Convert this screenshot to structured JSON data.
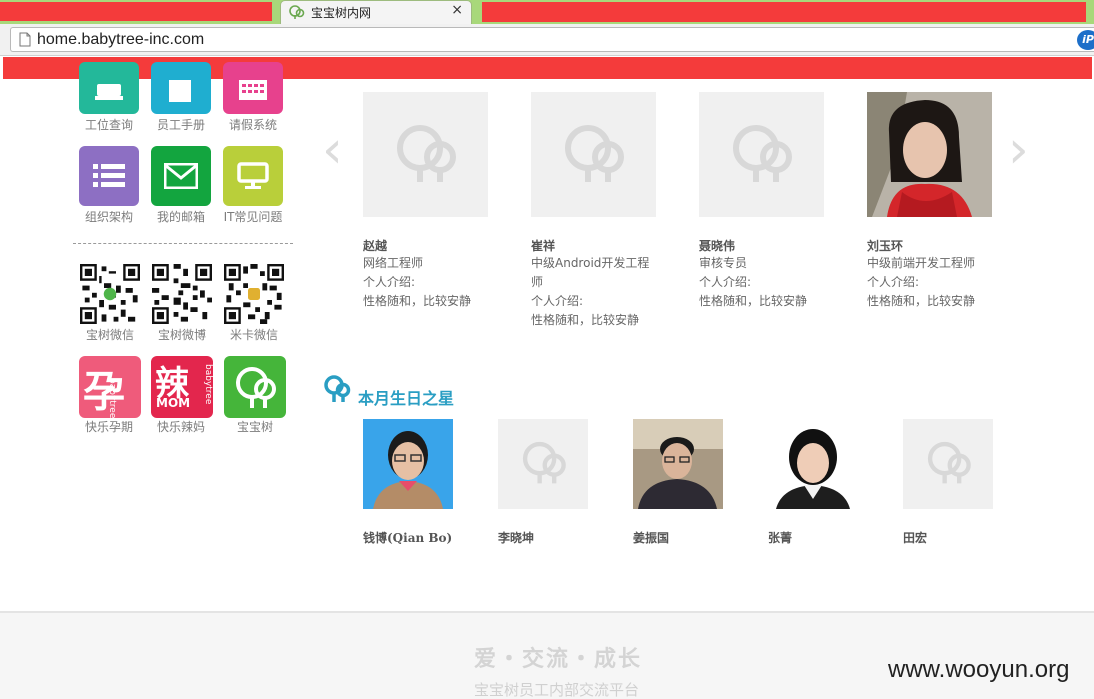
{
  "browser": {
    "tab_title": "宝宝树内网",
    "tab_close": "×",
    "url": "home.babytree-inc.com",
    "ip_badge": "iP"
  },
  "sidebar": {
    "apps": [
      {
        "label": "工位查询",
        "color": "#23b89a"
      },
      {
        "label": "员工手册",
        "color": "#1faed0"
      },
      {
        "label": "请假系统",
        "color": "#e7418d"
      },
      {
        "label": "组织架构",
        "color": "#8d6fc3"
      },
      {
        "label": "我的邮箱",
        "color": "#13a53f"
      },
      {
        "label": "IT常见问题",
        "color": "#b9cf3a"
      }
    ],
    "qr_codes": [
      {
        "label": "宝树微信"
      },
      {
        "label": "宝树微博"
      },
      {
        "label": "米卡微信"
      }
    ],
    "brands": [
      {
        "label": "快乐孕期",
        "glyph": "孕",
        "tag": "babytree",
        "color": "#ef5b7b"
      },
      {
        "label": "快乐辣妈",
        "glyph": "辣",
        "sub": "MOM",
        "tag": "babytree",
        "color": "#e3264d"
      },
      {
        "label": "宝宝树",
        "color": "#45b53a"
      }
    ]
  },
  "carousel": {
    "prev": "‹",
    "next": "›",
    "people": [
      {
        "name": "赵越",
        "title": "网络工程师",
        "intro_label": "个人介绍:",
        "intro": "性格随和，比较安静"
      },
      {
        "name": "崔祥",
        "title": "中级Android开发工程师",
        "intro_label": "个人介绍:",
        "intro": "性格随和，比较安静"
      },
      {
        "name": "聂晓伟",
        "title": "审核专员",
        "intro_label": "个人介绍:",
        "intro": "性格随和，比较安静"
      },
      {
        "name": "刘玉环",
        "title": "中级前端开发工程师",
        "intro_label": "个人介绍:",
        "intro": "性格随和，比较安静"
      }
    ]
  },
  "birthday": {
    "title": "本月生日之星",
    "people": [
      {
        "name": "钱博(Qian Bo)"
      },
      {
        "name": "李晓坤"
      },
      {
        "name": "姜振国"
      },
      {
        "name": "张菁"
      },
      {
        "name": "田宏"
      }
    ]
  },
  "footer": {
    "slogan": "爱・交流・成长",
    "subtitle": "宝宝树员工内部交流平台"
  },
  "watermark": "www.wooyun.org"
}
